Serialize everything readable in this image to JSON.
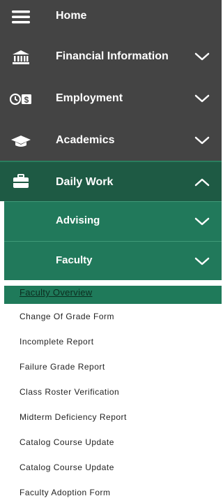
{
  "nav": {
    "home": {
      "label": "Home",
      "icon": "hamburger-icon"
    },
    "financial": {
      "label": "Financial Information",
      "icon": "bank-icon"
    },
    "employment": {
      "label": "Employment",
      "icon": "money-clock-icon"
    },
    "academics": {
      "label": "Academics",
      "icon": "graduation-cap-icon"
    },
    "daily_work": {
      "label": "Daily Work",
      "icon": "briefcase-icon",
      "expanded": true
    },
    "advising": {
      "label": "Advising"
    },
    "faculty": {
      "label": "Faculty",
      "expanded": true
    }
  },
  "faculty_links": [
    {
      "label": "Faculty Overview",
      "active": true
    },
    {
      "label": "Change Of Grade Form"
    },
    {
      "label": "Incomplete Report"
    },
    {
      "label": "Failure Grade Report"
    },
    {
      "label": "Class Roster Verification"
    },
    {
      "label": "Midterm Deficiency Report"
    },
    {
      "label": "Catalog Course Update"
    },
    {
      "label": "Catalog Course Update"
    },
    {
      "label": "Faculty Adoption Form"
    }
  ],
  "colors": {
    "menu_bg": "#444444",
    "active_section": "#1e5a44",
    "submenu_bg": "#21795b",
    "active_link": "#1f7a5a"
  }
}
